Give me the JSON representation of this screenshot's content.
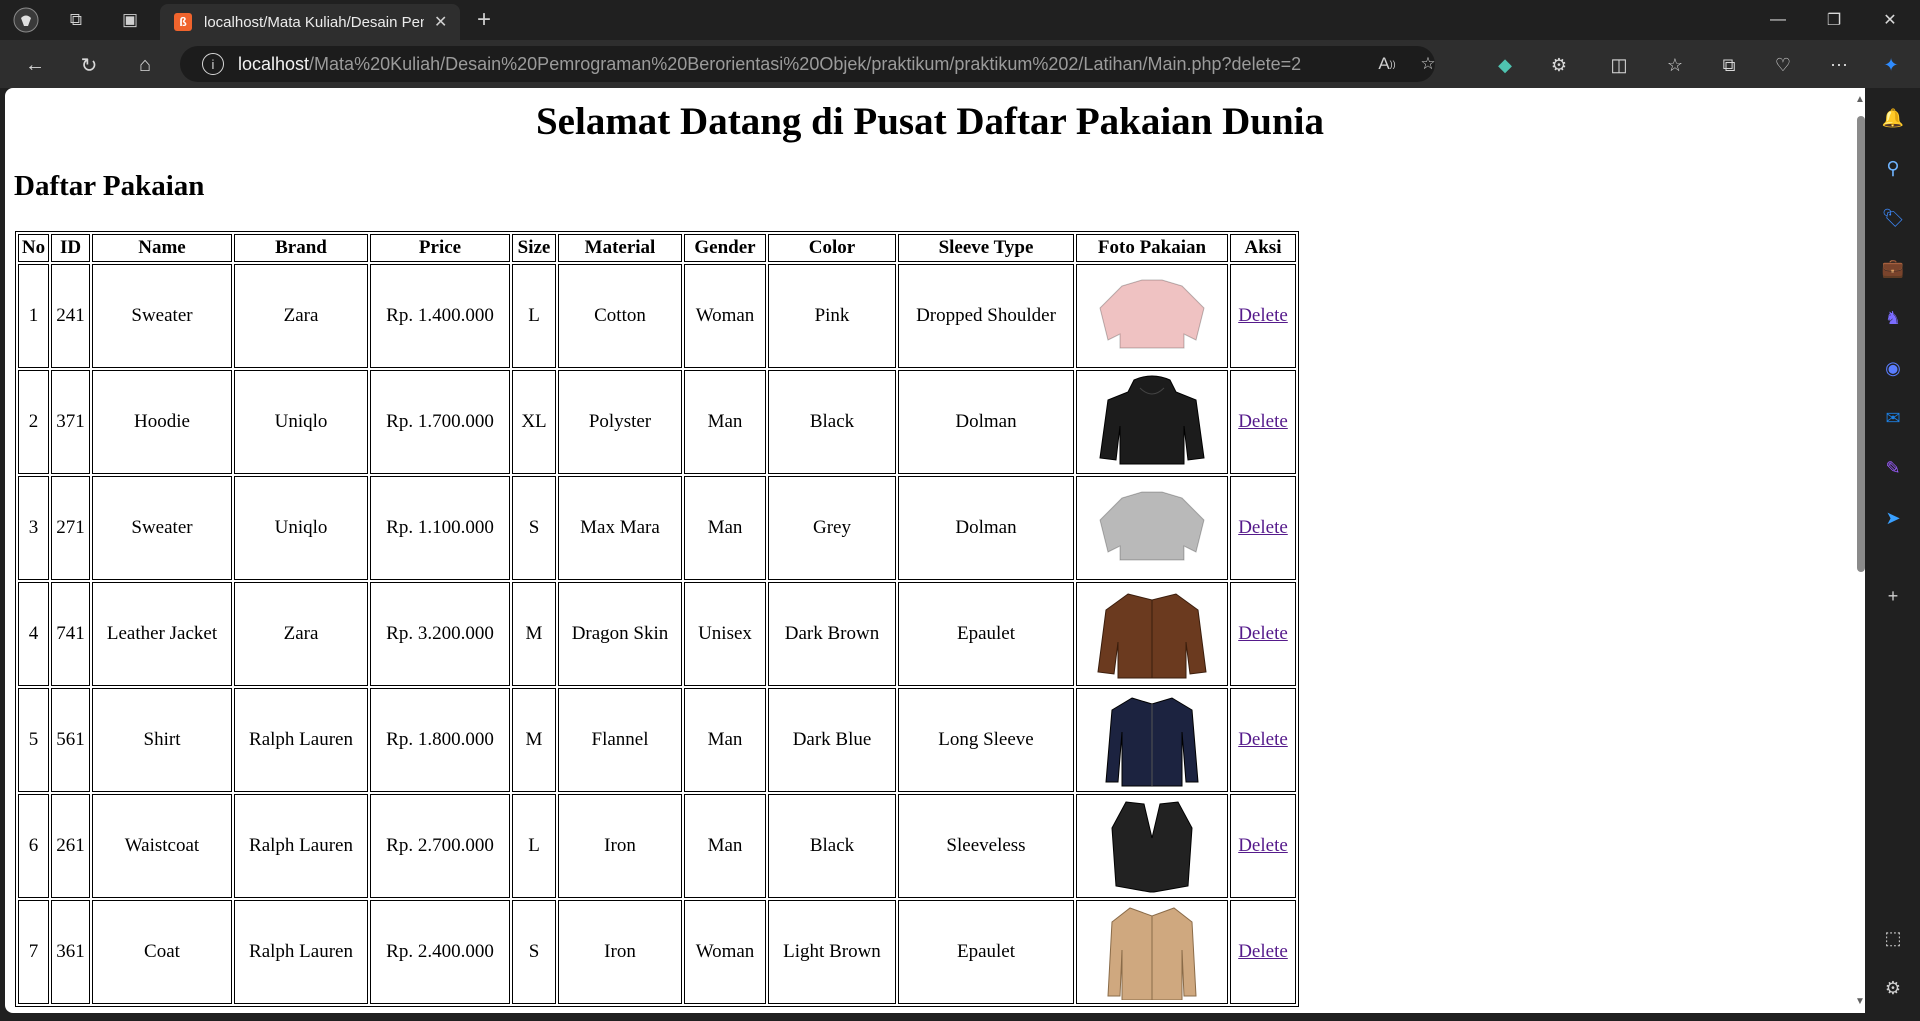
{
  "browser": {
    "tab_title": "localhost/Mata Kuliah/Desain Pemrograman",
    "url_host": "localhost",
    "url_path": "/Mata%20Kuliah/Desain%20Pemrograman%20Berorientasi%20Objek/praktikum/praktikum%202/Latihan/Main.php?delete=2"
  },
  "page": {
    "title": "Selamat Datang di Pusat Daftar Pakaian Dunia",
    "subtitle": "Daftar Pakaian"
  },
  "table": {
    "headers": [
      "No",
      "ID",
      "Name",
      "Brand",
      "Price",
      "Size",
      "Material",
      "Gender",
      "Color",
      "Sleeve Type",
      "Foto Pakaian",
      "Aksi"
    ],
    "rows": [
      {
        "no": "1",
        "id": "241",
        "name": "Sweater",
        "brand": "Zara",
        "price": "Rp. 1.400.000",
        "size": "L",
        "material": "Cotton",
        "gender": "Woman",
        "color": "Pink",
        "sleeve": "Dropped Shoulder",
        "action": "Delete",
        "photo_color": "#efc2c2",
        "photo_kind": "sweater"
      },
      {
        "no": "2",
        "id": "371",
        "name": "Hoodie",
        "brand": "Uniqlo",
        "price": "Rp. 1.700.000",
        "size": "XL",
        "material": "Polyster",
        "gender": "Man",
        "color": "Black",
        "sleeve": "Dolman",
        "action": "Delete",
        "photo_color": "#1c1c1c",
        "photo_kind": "hoodie"
      },
      {
        "no": "3",
        "id": "271",
        "name": "Sweater",
        "brand": "Uniqlo",
        "price": "Rp. 1.100.000",
        "size": "S",
        "material": "Max Mara",
        "gender": "Man",
        "color": "Grey",
        "sleeve": "Dolman",
        "action": "Delete",
        "photo_color": "#b9b9b9",
        "photo_kind": "sweater"
      },
      {
        "no": "4",
        "id": "741",
        "name": "Leather Jacket",
        "brand": "Zara",
        "price": "Rp. 3.200.000",
        "size": "M",
        "material": "Dragon Skin",
        "gender": "Unisex",
        "color": "Dark Brown",
        "sleeve": "Epaulet",
        "action": "Delete",
        "photo_color": "#6b3a1f",
        "photo_kind": "jacket"
      },
      {
        "no": "5",
        "id": "561",
        "name": "Shirt",
        "brand": "Ralph Lauren",
        "price": "Rp. 1.800.000",
        "size": "M",
        "material": "Flannel",
        "gender": "Man",
        "color": "Dark Blue",
        "sleeve": "Long Sleeve",
        "action": "Delete",
        "photo_color": "#1c2340",
        "photo_kind": "shirt"
      },
      {
        "no": "6",
        "id": "261",
        "name": "Waistcoat",
        "brand": "Ralph Lauren",
        "price": "Rp. 2.700.000",
        "size": "L",
        "material": "Iron",
        "gender": "Man",
        "color": "Black",
        "sleeve": "Sleeveless",
        "action": "Delete",
        "photo_color": "#222222",
        "photo_kind": "vest"
      },
      {
        "no": "7",
        "id": "361",
        "name": "Coat",
        "brand": "Ralph Lauren",
        "price": "Rp. 2.400.000",
        "size": "S",
        "material": "Iron",
        "gender": "Woman",
        "color": "Light Brown",
        "sleeve": "Epaulet",
        "action": "Delete",
        "photo_color": "#cfa87f",
        "photo_kind": "coat"
      }
    ]
  },
  "icons": {
    "accent": "#f0642d",
    "copilot": "#2f8cff"
  }
}
